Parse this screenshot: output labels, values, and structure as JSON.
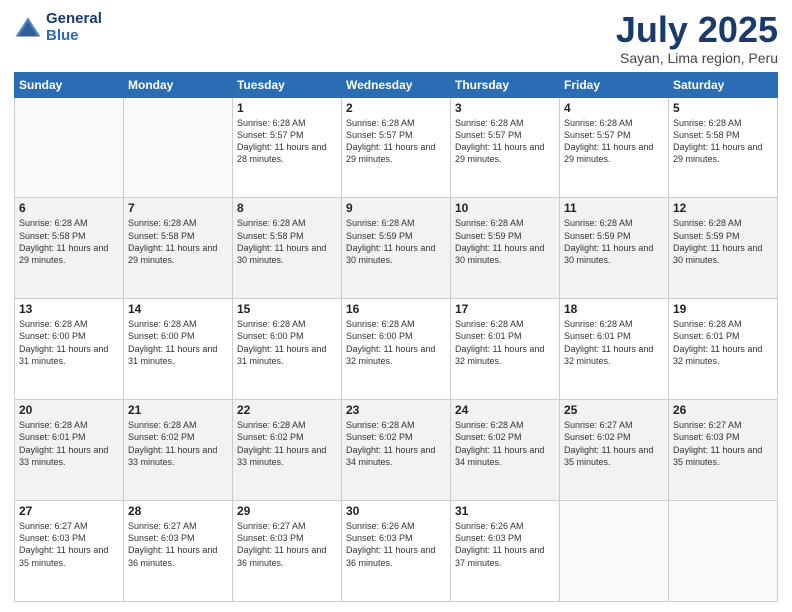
{
  "header": {
    "logo_line1": "General",
    "logo_line2": "Blue",
    "month": "July 2025",
    "location": "Sayan, Lima region, Peru"
  },
  "weekdays": [
    "Sunday",
    "Monday",
    "Tuesday",
    "Wednesday",
    "Thursday",
    "Friday",
    "Saturday"
  ],
  "weeks": [
    [
      {
        "day": "",
        "sunrise": "",
        "sunset": "",
        "daylight": ""
      },
      {
        "day": "",
        "sunrise": "",
        "sunset": "",
        "daylight": ""
      },
      {
        "day": "1",
        "sunrise": "Sunrise: 6:28 AM",
        "sunset": "Sunset: 5:57 PM",
        "daylight": "Daylight: 11 hours and 28 minutes."
      },
      {
        "day": "2",
        "sunrise": "Sunrise: 6:28 AM",
        "sunset": "Sunset: 5:57 PM",
        "daylight": "Daylight: 11 hours and 29 minutes."
      },
      {
        "day": "3",
        "sunrise": "Sunrise: 6:28 AM",
        "sunset": "Sunset: 5:57 PM",
        "daylight": "Daylight: 11 hours and 29 minutes."
      },
      {
        "day": "4",
        "sunrise": "Sunrise: 6:28 AM",
        "sunset": "Sunset: 5:57 PM",
        "daylight": "Daylight: 11 hours and 29 minutes."
      },
      {
        "day": "5",
        "sunrise": "Sunrise: 6:28 AM",
        "sunset": "Sunset: 5:58 PM",
        "daylight": "Daylight: 11 hours and 29 minutes."
      }
    ],
    [
      {
        "day": "6",
        "sunrise": "Sunrise: 6:28 AM",
        "sunset": "Sunset: 5:58 PM",
        "daylight": "Daylight: 11 hours and 29 minutes."
      },
      {
        "day": "7",
        "sunrise": "Sunrise: 6:28 AM",
        "sunset": "Sunset: 5:58 PM",
        "daylight": "Daylight: 11 hours and 29 minutes."
      },
      {
        "day": "8",
        "sunrise": "Sunrise: 6:28 AM",
        "sunset": "Sunset: 5:58 PM",
        "daylight": "Daylight: 11 hours and 30 minutes."
      },
      {
        "day": "9",
        "sunrise": "Sunrise: 6:28 AM",
        "sunset": "Sunset: 5:59 PM",
        "daylight": "Daylight: 11 hours and 30 minutes."
      },
      {
        "day": "10",
        "sunrise": "Sunrise: 6:28 AM",
        "sunset": "Sunset: 5:59 PM",
        "daylight": "Daylight: 11 hours and 30 minutes."
      },
      {
        "day": "11",
        "sunrise": "Sunrise: 6:28 AM",
        "sunset": "Sunset: 5:59 PM",
        "daylight": "Daylight: 11 hours and 30 minutes."
      },
      {
        "day": "12",
        "sunrise": "Sunrise: 6:28 AM",
        "sunset": "Sunset: 5:59 PM",
        "daylight": "Daylight: 11 hours and 30 minutes."
      }
    ],
    [
      {
        "day": "13",
        "sunrise": "Sunrise: 6:28 AM",
        "sunset": "Sunset: 6:00 PM",
        "daylight": "Daylight: 11 hours and 31 minutes."
      },
      {
        "day": "14",
        "sunrise": "Sunrise: 6:28 AM",
        "sunset": "Sunset: 6:00 PM",
        "daylight": "Daylight: 11 hours and 31 minutes."
      },
      {
        "day": "15",
        "sunrise": "Sunrise: 6:28 AM",
        "sunset": "Sunset: 6:00 PM",
        "daylight": "Daylight: 11 hours and 31 minutes."
      },
      {
        "day": "16",
        "sunrise": "Sunrise: 6:28 AM",
        "sunset": "Sunset: 6:00 PM",
        "daylight": "Daylight: 11 hours and 32 minutes."
      },
      {
        "day": "17",
        "sunrise": "Sunrise: 6:28 AM",
        "sunset": "Sunset: 6:01 PM",
        "daylight": "Daylight: 11 hours and 32 minutes."
      },
      {
        "day": "18",
        "sunrise": "Sunrise: 6:28 AM",
        "sunset": "Sunset: 6:01 PM",
        "daylight": "Daylight: 11 hours and 32 minutes."
      },
      {
        "day": "19",
        "sunrise": "Sunrise: 6:28 AM",
        "sunset": "Sunset: 6:01 PM",
        "daylight": "Daylight: 11 hours and 32 minutes."
      }
    ],
    [
      {
        "day": "20",
        "sunrise": "Sunrise: 6:28 AM",
        "sunset": "Sunset: 6:01 PM",
        "daylight": "Daylight: 11 hours and 33 minutes."
      },
      {
        "day": "21",
        "sunrise": "Sunrise: 6:28 AM",
        "sunset": "Sunset: 6:02 PM",
        "daylight": "Daylight: 11 hours and 33 minutes."
      },
      {
        "day": "22",
        "sunrise": "Sunrise: 6:28 AM",
        "sunset": "Sunset: 6:02 PM",
        "daylight": "Daylight: 11 hours and 33 minutes."
      },
      {
        "day": "23",
        "sunrise": "Sunrise: 6:28 AM",
        "sunset": "Sunset: 6:02 PM",
        "daylight": "Daylight: 11 hours and 34 minutes."
      },
      {
        "day": "24",
        "sunrise": "Sunrise: 6:28 AM",
        "sunset": "Sunset: 6:02 PM",
        "daylight": "Daylight: 11 hours and 34 minutes."
      },
      {
        "day": "25",
        "sunrise": "Sunrise: 6:27 AM",
        "sunset": "Sunset: 6:02 PM",
        "daylight": "Daylight: 11 hours and 35 minutes."
      },
      {
        "day": "26",
        "sunrise": "Sunrise: 6:27 AM",
        "sunset": "Sunset: 6:03 PM",
        "daylight": "Daylight: 11 hours and 35 minutes."
      }
    ],
    [
      {
        "day": "27",
        "sunrise": "Sunrise: 6:27 AM",
        "sunset": "Sunset: 6:03 PM",
        "daylight": "Daylight: 11 hours and 35 minutes."
      },
      {
        "day": "28",
        "sunrise": "Sunrise: 6:27 AM",
        "sunset": "Sunset: 6:03 PM",
        "daylight": "Daylight: 11 hours and 36 minutes."
      },
      {
        "day": "29",
        "sunrise": "Sunrise: 6:27 AM",
        "sunset": "Sunset: 6:03 PM",
        "daylight": "Daylight: 11 hours and 36 minutes."
      },
      {
        "day": "30",
        "sunrise": "Sunrise: 6:26 AM",
        "sunset": "Sunset: 6:03 PM",
        "daylight": "Daylight: 11 hours and 36 minutes."
      },
      {
        "day": "31",
        "sunrise": "Sunrise: 6:26 AM",
        "sunset": "Sunset: 6:03 PM",
        "daylight": "Daylight: 11 hours and 37 minutes."
      },
      {
        "day": "",
        "sunrise": "",
        "sunset": "",
        "daylight": ""
      },
      {
        "day": "",
        "sunrise": "",
        "sunset": "",
        "daylight": ""
      }
    ]
  ]
}
